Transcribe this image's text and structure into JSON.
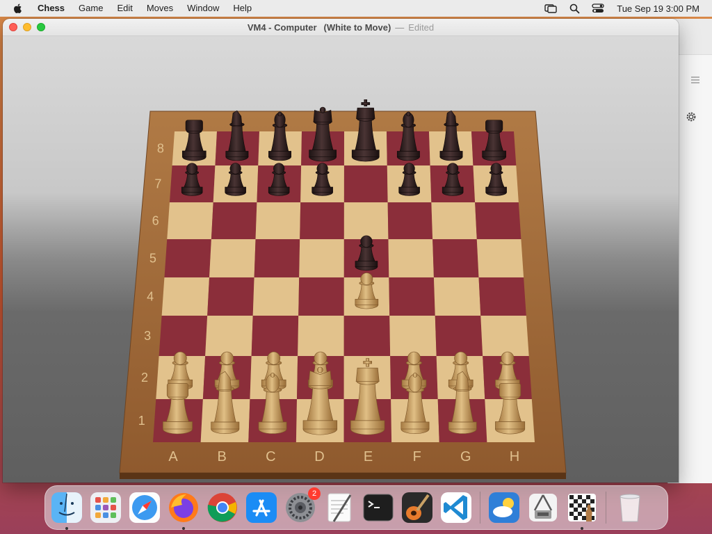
{
  "menubar": {
    "app_name": "Chess",
    "menus": [
      "Game",
      "Edit",
      "Moves",
      "Window",
      "Help"
    ],
    "clock": "Tue Sep 19  3:00 PM"
  },
  "window": {
    "title": "VM4 - Computer",
    "status": "(White to Move)",
    "separator": "—",
    "edited": "Edited"
  },
  "board": {
    "files": [
      "A",
      "B",
      "C",
      "D",
      "E",
      "F",
      "G",
      "H"
    ],
    "ranks": [
      "8",
      "7",
      "6",
      "5",
      "4",
      "3",
      "2",
      "1"
    ],
    "pieces": [
      {
        "square": "a8",
        "color": "black",
        "type": "rook"
      },
      {
        "square": "b8",
        "color": "black",
        "type": "knight"
      },
      {
        "square": "c8",
        "color": "black",
        "type": "bishop"
      },
      {
        "square": "d8",
        "color": "black",
        "type": "queen"
      },
      {
        "square": "e8",
        "color": "black",
        "type": "king"
      },
      {
        "square": "f8",
        "color": "black",
        "type": "bishop"
      },
      {
        "square": "g8",
        "color": "black",
        "type": "knight"
      },
      {
        "square": "h8",
        "color": "black",
        "type": "rook"
      },
      {
        "square": "a7",
        "color": "black",
        "type": "pawn"
      },
      {
        "square": "b7",
        "color": "black",
        "type": "pawn"
      },
      {
        "square": "c7",
        "color": "black",
        "type": "pawn"
      },
      {
        "square": "d7",
        "color": "black",
        "type": "pawn"
      },
      {
        "square": "f7",
        "color": "black",
        "type": "pawn"
      },
      {
        "square": "g7",
        "color": "black",
        "type": "pawn"
      },
      {
        "square": "h7",
        "color": "black",
        "type": "pawn"
      },
      {
        "square": "e5",
        "color": "black",
        "type": "pawn"
      },
      {
        "square": "e4",
        "color": "white",
        "type": "pawn"
      },
      {
        "square": "a2",
        "color": "white",
        "type": "pawn"
      },
      {
        "square": "b2",
        "color": "white",
        "type": "pawn"
      },
      {
        "square": "c2",
        "color": "white",
        "type": "pawn"
      },
      {
        "square": "d2",
        "color": "white",
        "type": "pawn"
      },
      {
        "square": "f2",
        "color": "white",
        "type": "pawn"
      },
      {
        "square": "g2",
        "color": "white",
        "type": "pawn"
      },
      {
        "square": "h2",
        "color": "white",
        "type": "pawn"
      },
      {
        "square": "a1",
        "color": "white",
        "type": "rook"
      },
      {
        "square": "b1",
        "color": "white",
        "type": "knight"
      },
      {
        "square": "c1",
        "color": "white",
        "type": "bishop"
      },
      {
        "square": "d1",
        "color": "white",
        "type": "queen"
      },
      {
        "square": "e1",
        "color": "white",
        "type": "king"
      },
      {
        "square": "f1",
        "color": "white",
        "type": "bishop"
      },
      {
        "square": "g1",
        "color": "white",
        "type": "knight"
      },
      {
        "square": "h1",
        "color": "white",
        "type": "rook"
      }
    ],
    "colors": {
      "light_square": "#e2c28c",
      "dark_square": "#8b2e3a",
      "frame": "#a06a3a",
      "black_piece": "#2a1f1f",
      "white_piece": "#c9a165"
    }
  },
  "dock": {
    "apps": [
      {
        "name": "Finder",
        "icon": "finder-icon"
      },
      {
        "name": "Launchpad",
        "icon": "launchpad-icon"
      },
      {
        "name": "Safari",
        "icon": "safari-icon"
      },
      {
        "name": "Firefox",
        "icon": "firefox-icon"
      },
      {
        "name": "Chrome",
        "icon": "chrome-icon"
      },
      {
        "name": "App Store",
        "icon": "appstore-icon"
      },
      {
        "name": "System Settings",
        "icon": "settings-icon",
        "badge": "2"
      },
      {
        "name": "TextEdit",
        "icon": "textedit-icon"
      },
      {
        "name": "Terminal",
        "icon": "terminal-icon"
      },
      {
        "name": "GarageBand",
        "icon": "garageband-icon"
      },
      {
        "name": "VS Code",
        "icon": "vscode-icon"
      },
      {
        "name": "Weather",
        "icon": "weather-icon"
      },
      {
        "name": "Archive Utility",
        "icon": "archive-icon"
      },
      {
        "name": "Chess",
        "icon": "chess-icon"
      },
      {
        "name": "Trash",
        "icon": "trash-icon"
      }
    ]
  }
}
